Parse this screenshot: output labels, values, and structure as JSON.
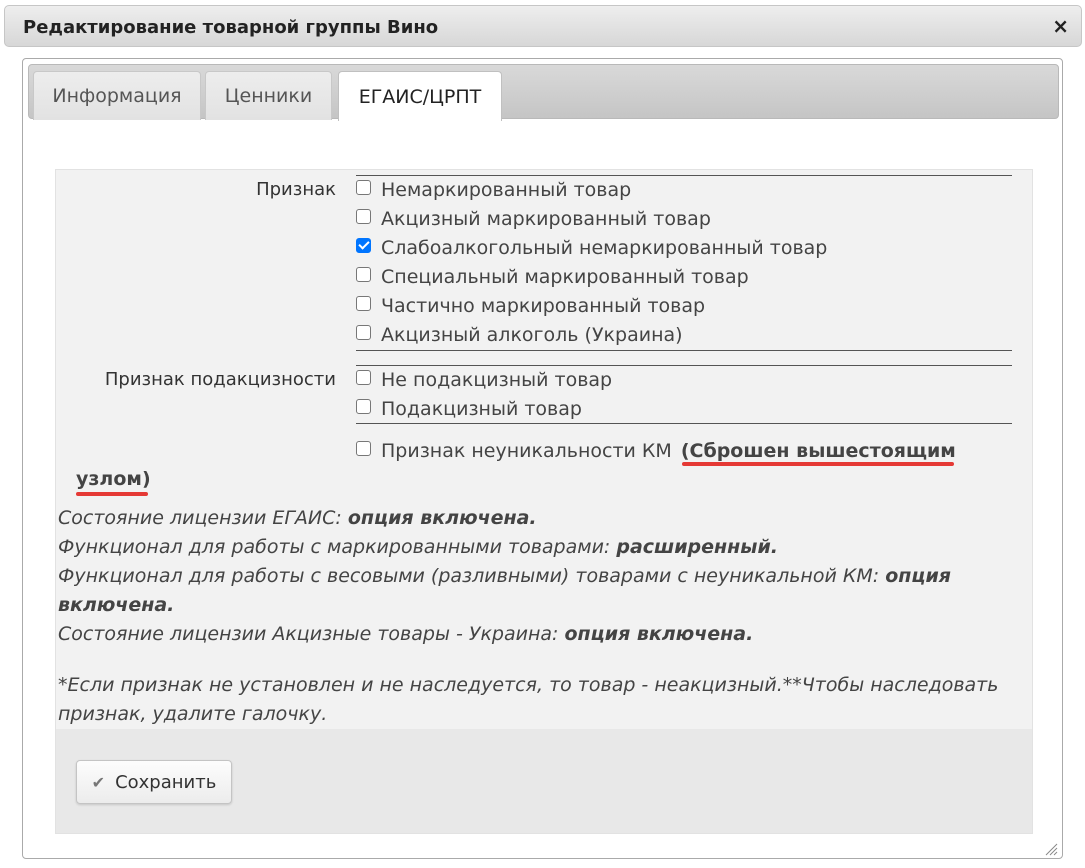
{
  "dialog": {
    "title": "Редактирование товарной группы Вино",
    "close_glyph": "×"
  },
  "tabs": [
    {
      "label": "Информация",
      "active": false
    },
    {
      "label": "Ценники",
      "active": false
    },
    {
      "label": "ЕГАИС/ЦРПТ",
      "active": true
    }
  ],
  "attribute": {
    "label": "Признак",
    "options": [
      {
        "label": "Немаркированный товар",
        "checked": false
      },
      {
        "label": "Акцизный маркированный товар",
        "checked": false
      },
      {
        "label": "Слабоалкогольный немаркированный товар",
        "checked": true
      },
      {
        "label": "Специальный маркированный товар",
        "checked": false
      },
      {
        "label": "Частично маркированный товар",
        "checked": false
      },
      {
        "label": "Акцизный алкоголь (Украина)",
        "checked": false
      }
    ]
  },
  "excise": {
    "label": "Признак подакцизности",
    "options": [
      {
        "label": "Не подакцизный товар",
        "checked": false
      },
      {
        "label": "Подакцизный товар",
        "checked": false
      }
    ]
  },
  "nonunique": {
    "label": "Признак неуникальности КМ",
    "checked": false,
    "note_open": "(Сброшен вышестоящим",
    "note_close": "узлом",
    "note_paren": ")"
  },
  "info": {
    "egais_label": "Состояние лицензии ЕГАИС: ",
    "egais_value": "опция включена.",
    "marked_label": "Функционал для работы с маркированными товарами: ",
    "marked_value": "расширенный.",
    "weight_label": "Функционал для работы с весовыми (разливными) товарами с неуникальной КМ: ",
    "weight_value_1": "опция",
    "weight_value_2": "включена.",
    "ukraine_label": "Состояние лицензии Акцизные товары - Украина: ",
    "ukraine_value": "опция включена.",
    "footnote_1": "*Если признак не установлен и не наследуется, то товар - неакцизный.**Чтобы наследовать",
    "footnote_2": "признак, удалите галочку."
  },
  "save_button": {
    "label": "Сохранить",
    "icon": "check-icon"
  },
  "colors": {
    "accent_check": "#0075ff",
    "underline_red": "#e53935"
  }
}
